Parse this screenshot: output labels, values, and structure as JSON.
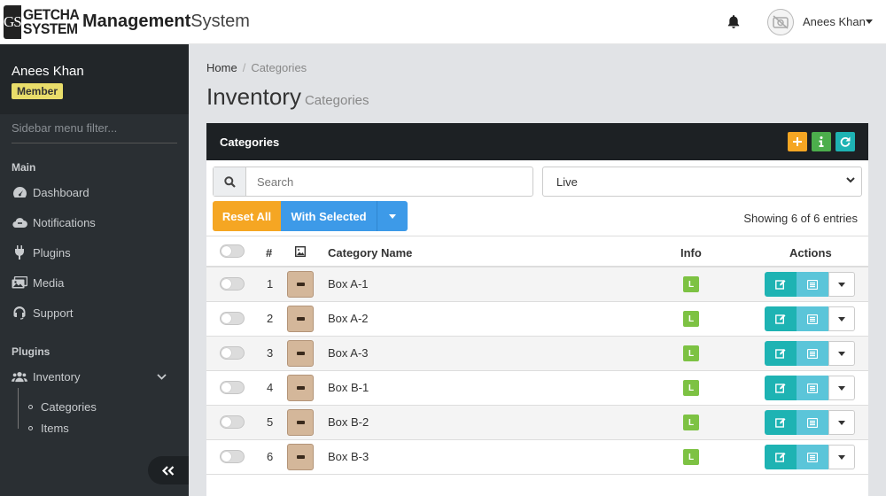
{
  "brand": {
    "logo_mark": "GS",
    "logo_line1": "GETCHA",
    "logo_line2": "SYSTEM",
    "title_bold": "Management",
    "title_rest": "System"
  },
  "topbar": {
    "user_name": "Anees Khan",
    "icons": [
      "bell-icon",
      "avatar-icon",
      "caret-down-icon"
    ]
  },
  "sidebar": {
    "user_name": "Anees Khan",
    "role_badge": "Member",
    "filter_placeholder": "Sidebar menu filter...",
    "sections": [
      {
        "label": "Main",
        "items": [
          {
            "label": "Dashboard",
            "icon": "dashboard-icon"
          },
          {
            "label": "Notifications",
            "icon": "cloud-icon"
          },
          {
            "label": "Plugins",
            "icon": "plug-icon"
          },
          {
            "label": "Media",
            "icon": "images-icon"
          },
          {
            "label": "Support",
            "icon": "headset-icon"
          }
        ]
      },
      {
        "label": "Plugins",
        "items": [
          {
            "label": "Inventory",
            "icon": "users-icon",
            "expanded": true,
            "children": [
              "Categories",
              "Items"
            ]
          }
        ]
      }
    ]
  },
  "breadcrumb": {
    "home": "Home",
    "separator": "/",
    "current": "Categories"
  },
  "page": {
    "title": "Inventory",
    "subtitle": "Categories"
  },
  "panel": {
    "title": "Categories",
    "search_placeholder": "Search",
    "status_select": "Live",
    "reset_label": "Reset All",
    "with_selected_label": "With Selected",
    "entries_text": "Showing 6 of 6 entries",
    "columns": [
      "#",
      "Category Name",
      "Info",
      "Actions"
    ],
    "rows": [
      {
        "num": "1",
        "name": "Box A-1",
        "info": "L"
      },
      {
        "num": "2",
        "name": "Box A-2",
        "info": "L"
      },
      {
        "num": "3",
        "name": "Box A-3",
        "info": "L"
      },
      {
        "num": "4",
        "name": "Box B-1",
        "info": "L"
      },
      {
        "num": "5",
        "name": "Box B-2",
        "info": "L"
      },
      {
        "num": "6",
        "name": "Box B-3",
        "info": "L"
      }
    ]
  },
  "colors": {
    "sidebar": "#2a2f33",
    "panel_head": "#1d2124",
    "orange": "#f5a623",
    "blue": "#3d9ae8",
    "teal": "#1eb3b3",
    "green": "#7dc243",
    "badge": "#e9dd6a"
  }
}
